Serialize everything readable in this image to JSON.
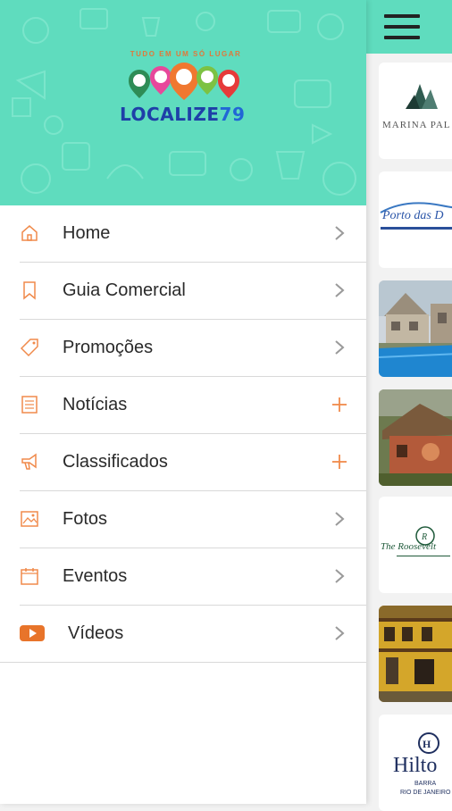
{
  "app": {
    "logo_tagline": "TUDO EM UM SÓ LUGAR",
    "logo_name": "LOCALIZE",
    "logo_number": "79"
  },
  "colors": {
    "header": "#5fdcbe",
    "accent": "#f08a4b",
    "text": "#2a2a2a",
    "chevron": "#9a9a9a",
    "youtube": "#e8742a"
  },
  "menu": {
    "items": [
      {
        "label": "Home",
        "icon": "home-icon",
        "action": "chevron"
      },
      {
        "label": "Guia Comercial",
        "icon": "bookmark-icon",
        "action": "chevron"
      },
      {
        "label": "Promoções",
        "icon": "tag-icon",
        "action": "chevron"
      },
      {
        "label": "Notícias",
        "icon": "newspaper-icon",
        "action": "plus"
      },
      {
        "label": "Classificados",
        "icon": "megaphone-icon",
        "action": "plus"
      },
      {
        "label": "Fotos",
        "icon": "photo-icon",
        "action": "chevron"
      },
      {
        "label": "Eventos",
        "icon": "calendar-icon",
        "action": "chevron"
      },
      {
        "label": "Vídeos",
        "icon": "video-play-icon",
        "action": "chevron"
      }
    ]
  },
  "cards": [
    {
      "name": "card-marina-palace",
      "text": "MARINA PAL"
    },
    {
      "name": "card-porto-das-dunas",
      "text": "Porto das D"
    },
    {
      "name": "card-pool-house",
      "text": ""
    },
    {
      "name": "card-cottage",
      "text": ""
    },
    {
      "name": "card-roosevelt",
      "text": "The Roosevelt"
    },
    {
      "name": "card-yellow-house",
      "text": ""
    },
    {
      "name": "card-hilton",
      "text": "Hilto",
      "sub1": "BARRA",
      "sub2": "RIO DE JANEIRO"
    }
  ]
}
